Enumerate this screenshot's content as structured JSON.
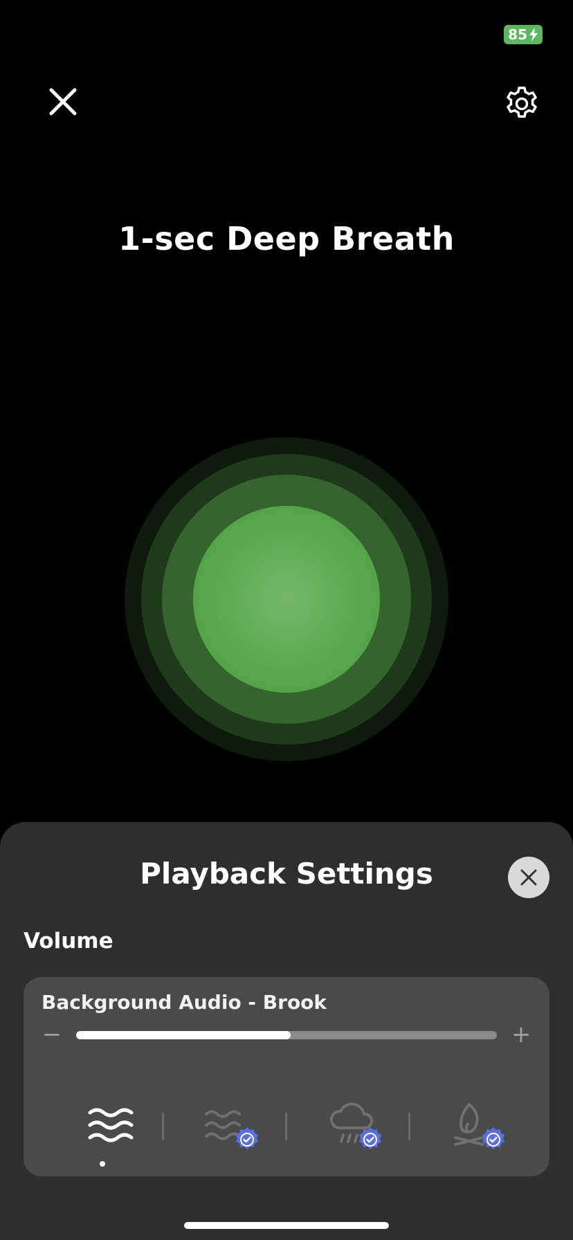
{
  "status_bar": {
    "battery_level": "85"
  },
  "header": {
    "title": "1-sec Deep Breath"
  },
  "colors": {
    "accent_green": "#5aa84e",
    "badge_blue": "#5b6ee1",
    "sheet_bg": "#2e2e2e",
    "card_bg": "#4a4a4a"
  },
  "breathing_visual": {
    "rings": 4
  },
  "playback_settings": {
    "title": "Playback Settings",
    "section_label": "Volume",
    "audio": {
      "label": "Background Audio - Brook",
      "minus_label": "−",
      "plus_label": "+",
      "volume_percent": 51
    },
    "sounds": [
      {
        "icon": "waves-icon",
        "selected": true,
        "premium": false
      },
      {
        "icon": "ocean-waves-icon",
        "selected": false,
        "premium": true
      },
      {
        "icon": "rain-cloud-icon",
        "selected": false,
        "premium": true
      },
      {
        "icon": "campfire-icon",
        "selected": false,
        "premium": true
      }
    ]
  }
}
